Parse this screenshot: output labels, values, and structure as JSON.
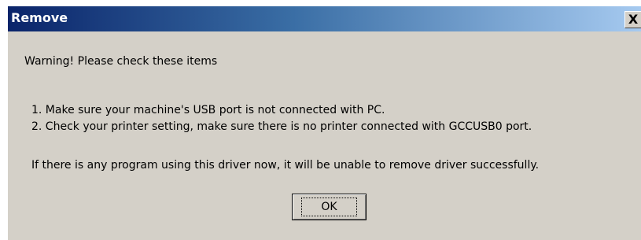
{
  "window": {
    "title": "Remove",
    "close_symbol": "X",
    "close_icon": "close-icon"
  },
  "message": {
    "warning": "Warning! Please check these items",
    "items": [
      "1. Make sure your machine's USB port is not connected with PC.",
      "2. Check your printer setting, make sure there is no printer connected with GCCUSB0 port."
    ],
    "note": "If there is any program using this driver now, it will be unable to remove driver successfully."
  },
  "buttons": {
    "ok_label": "OK"
  },
  "colors": {
    "titlebar_start": "#0a246a",
    "titlebar_end": "#a6caf0",
    "dialog_bg": "#d4d0c8"
  }
}
